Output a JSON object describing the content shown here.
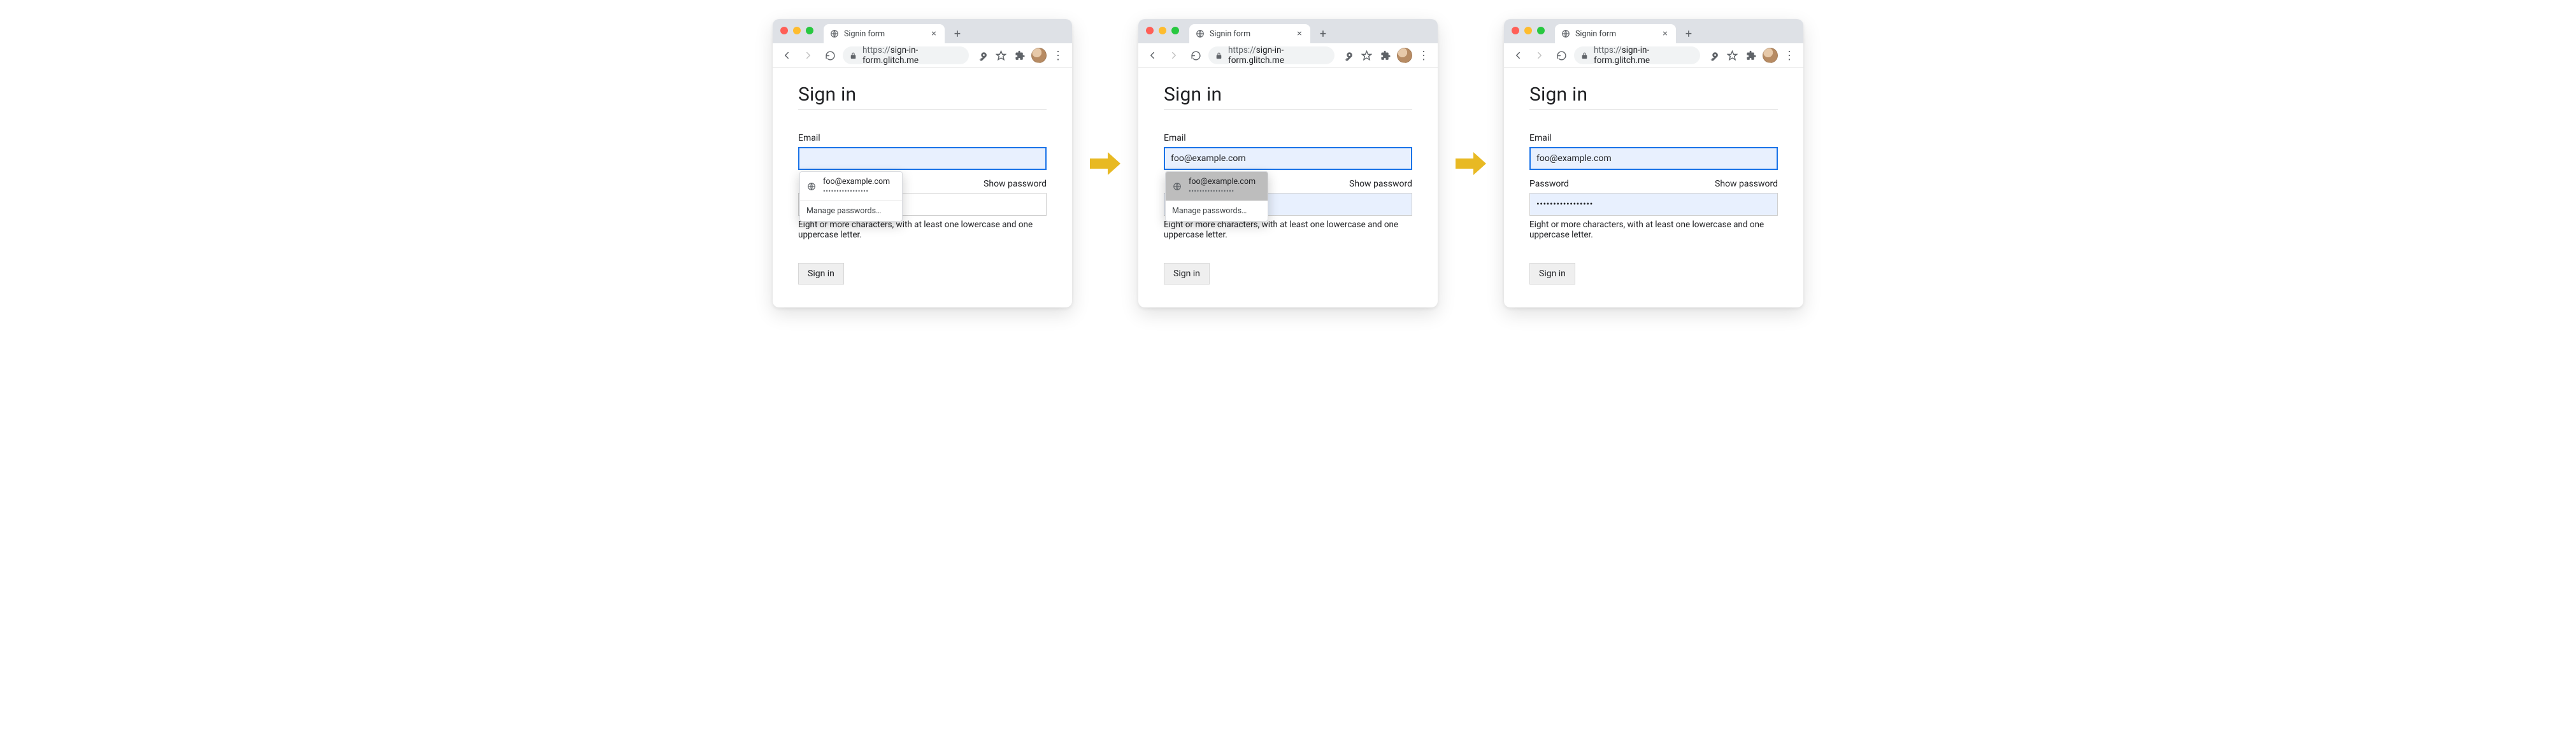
{
  "browser": {
    "tab_title": "Signin form",
    "url_prefix": "https://",
    "url_host": "sign-in-form.glitch.me",
    "new_tab_glyph": "+",
    "close_tab_glyph": "×",
    "menu_glyph": "⋮"
  },
  "page": {
    "title": "Sign in",
    "email_label": "Email",
    "password_label": "Password",
    "show_password": "Show password",
    "hint": "Eight or more characters, with at least one lowercase and one uppercase letter.",
    "signin_button": "Sign in"
  },
  "autofill": {
    "email": "foo@example.com",
    "password_dots": "•••••••••••••••••",
    "manage": "Manage passwords…"
  },
  "state1": {
    "email_value": "",
    "password_value": ""
  },
  "state2": {
    "email_value": "foo@example.com",
    "password_value": ""
  },
  "state3": {
    "email_value": "foo@example.com",
    "password_value": "•••••••••••••••••"
  }
}
